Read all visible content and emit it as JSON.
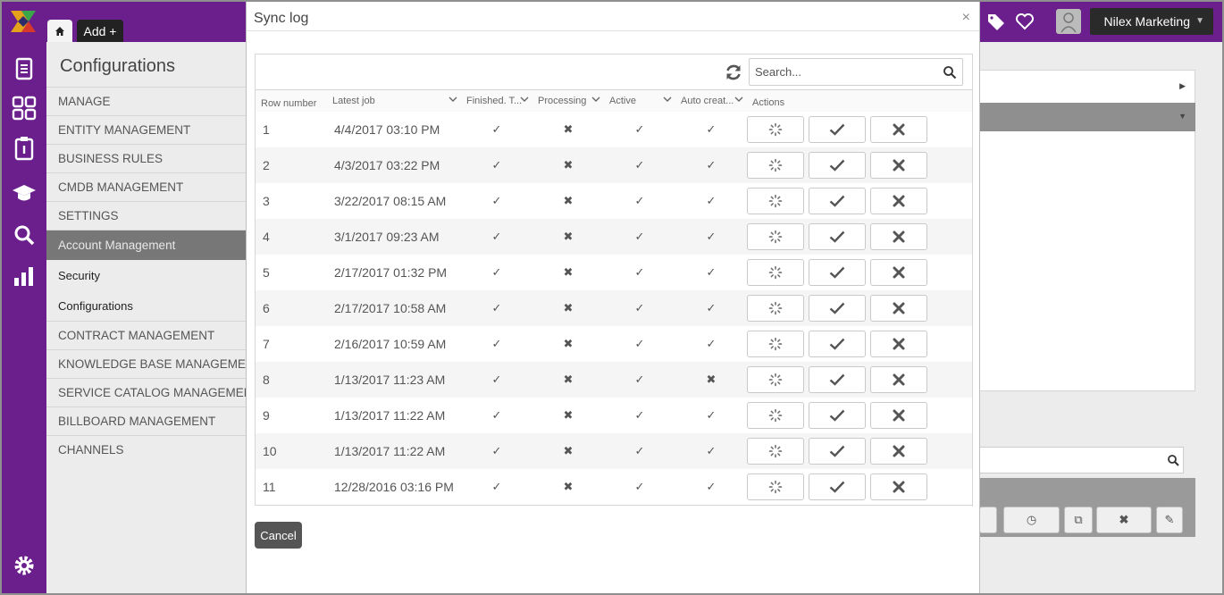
{
  "topbar": {
    "add_tab_label": "Add +",
    "user_name": "Nilex Marketing"
  },
  "nav": {
    "title": "Configurations",
    "items": [
      {
        "label": "MANAGE",
        "kind": "item"
      },
      {
        "label": "ENTITY MANAGEMENT",
        "kind": "item"
      },
      {
        "label": "BUSINESS RULES",
        "kind": "item"
      },
      {
        "label": "CMDB MANAGEMENT",
        "kind": "item"
      },
      {
        "label": "SETTINGS",
        "kind": "item"
      },
      {
        "label": "Account Management",
        "kind": "active"
      },
      {
        "label": "Security",
        "kind": "sub"
      },
      {
        "label": "Configurations",
        "kind": "sub"
      },
      {
        "label": "CONTRACT MANAGEMENT",
        "kind": "item"
      },
      {
        "label": "KNOWLEDGE BASE MANAGEMENT",
        "kind": "item"
      },
      {
        "label": "SERVICE CATALOG MANAGEMENT",
        "kind": "item"
      },
      {
        "label": "BILLBOARD MANAGEMENT",
        "kind": "item"
      },
      {
        "label": "CHANNELS",
        "kind": "item"
      }
    ]
  },
  "modal": {
    "title": "Sync log",
    "close_glyph": "×",
    "search_placeholder": "Search...",
    "cancel_label": "Cancel",
    "columns": {
      "row_number": "Row number",
      "latest_job": "Latest job",
      "finished": "Finished. T...",
      "processing": "Processing",
      "active": "Active",
      "auto_created": "Auto creat...",
      "actions": "Actions"
    },
    "rows": [
      {
        "num": "1",
        "date": "4/4/2017 03:10 PM",
        "finished": "✓",
        "processing": "✖",
        "active": "✓",
        "auto": "✓"
      },
      {
        "num": "2",
        "date": "4/3/2017 03:22 PM",
        "finished": "✓",
        "processing": "✖",
        "active": "✓",
        "auto": "✓"
      },
      {
        "num": "3",
        "date": "3/22/2017 08:15 AM",
        "finished": "✓",
        "processing": "✖",
        "active": "✓",
        "auto": "✓"
      },
      {
        "num": "4",
        "date": "3/1/2017 09:23 AM",
        "finished": "✓",
        "processing": "✖",
        "active": "✓",
        "auto": "✓"
      },
      {
        "num": "5",
        "date": "2/17/2017 01:32 PM",
        "finished": "✓",
        "processing": "✖",
        "active": "✓",
        "auto": "✓"
      },
      {
        "num": "6",
        "date": "2/17/2017 10:58 AM",
        "finished": "✓",
        "processing": "✖",
        "active": "✓",
        "auto": "✓"
      },
      {
        "num": "7",
        "date": "2/16/2017 10:59 AM",
        "finished": "✓",
        "processing": "✖",
        "active": "✓",
        "auto": "✓"
      },
      {
        "num": "8",
        "date": "1/13/2017 11:23 AM",
        "finished": "✓",
        "processing": "✖",
        "active": "✓",
        "auto": "✖"
      },
      {
        "num": "9",
        "date": "1/13/2017 11:22 AM",
        "finished": "✓",
        "processing": "✖",
        "active": "✓",
        "auto": "✓"
      },
      {
        "num": "10",
        "date": "1/13/2017 11:22 AM",
        "finished": "✓",
        "processing": "✖",
        "active": "✓",
        "auto": "✓"
      },
      {
        "num": "11",
        "date": "12/28/2016 03:16 PM",
        "finished": "✓",
        "processing": "✖",
        "active": "✓",
        "auto": "✓"
      }
    ],
    "row_actions": [
      "spinner-icon",
      "check-icon",
      "times-icon"
    ]
  },
  "colors": {
    "brand_purple": "#6b1f8c",
    "active_nav": "#777777",
    "cancel_button": "#555555"
  }
}
